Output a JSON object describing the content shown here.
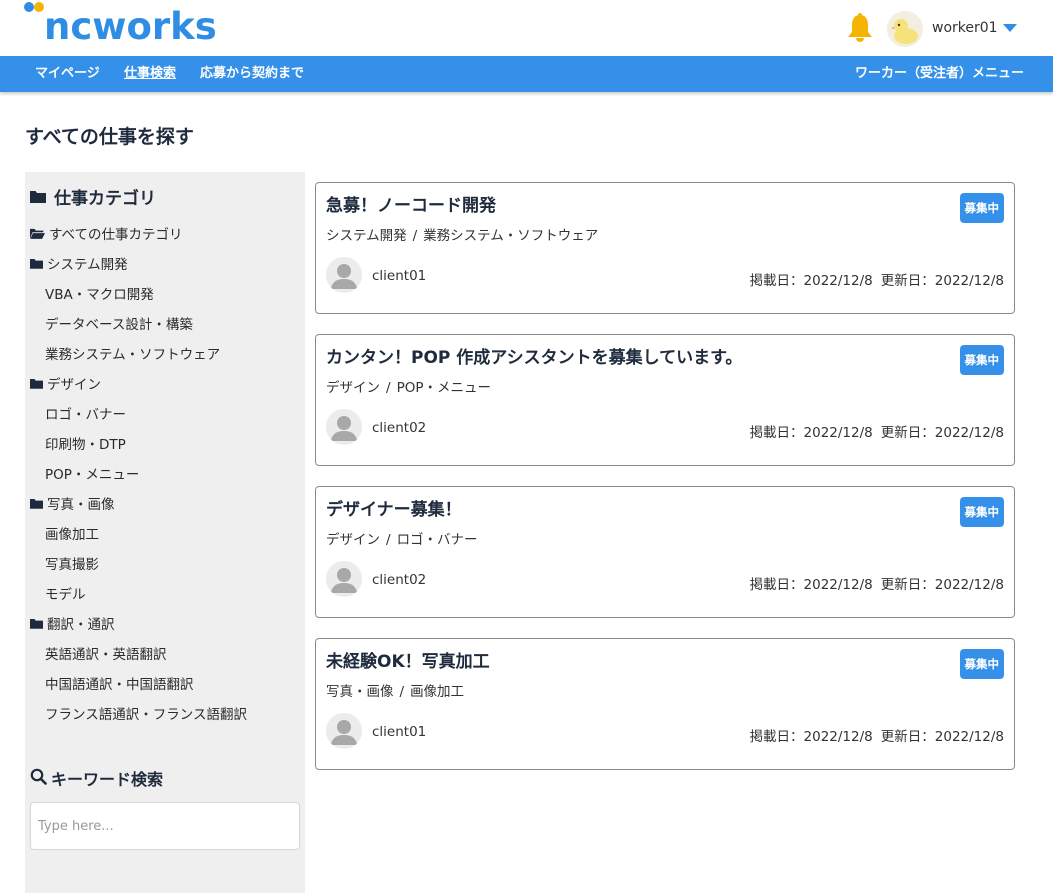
{
  "header": {
    "logo_text": "ncworks",
    "username": "worker01",
    "colors": {
      "brand": "#2f8de4",
      "logo_dot_yellow": "#f5b400",
      "bell": "#f5b400"
    },
    "icons": [
      "bell-icon",
      "user-avatar-chick",
      "caret-down-icon"
    ]
  },
  "nav": {
    "items": [
      {
        "label": "マイページ",
        "active": false
      },
      {
        "label": "仕事検索",
        "active": true
      },
      {
        "label": "応募から契約まで",
        "active": false
      }
    ],
    "right_label": "ワーカー（受注者）メニュー",
    "color": "#3490e8"
  },
  "page_title": "すべての仕事を探す",
  "sidebar": {
    "category_heading": "仕事カテゴリ",
    "categories": [
      {
        "label": "すべての仕事カテゴリ",
        "level": "top",
        "icon": "folder-open-icon"
      },
      {
        "label": "システム開発",
        "level": "top",
        "icon": "folder-icon"
      },
      {
        "label": "VBA・マクロ開発",
        "level": "sub"
      },
      {
        "label": "データベース設計・構築",
        "level": "sub"
      },
      {
        "label": "業務システム・ソフトウェア",
        "level": "sub"
      },
      {
        "label": "デザイン",
        "level": "top",
        "icon": "folder-icon"
      },
      {
        "label": "ロゴ・バナー",
        "level": "sub"
      },
      {
        "label": "印刷物・DTP",
        "level": "sub"
      },
      {
        "label": "POP・メニュー",
        "level": "sub"
      },
      {
        "label": "写真・画像",
        "level": "top",
        "icon": "folder-icon"
      },
      {
        "label": "画像加工",
        "level": "sub"
      },
      {
        "label": "写真撮影",
        "level": "sub"
      },
      {
        "label": "モデル",
        "level": "sub"
      },
      {
        "label": "翻訳・通訳",
        "level": "top",
        "icon": "folder-icon"
      },
      {
        "label": "英語通訳・英語翻訳",
        "level": "sub"
      },
      {
        "label": "中国語通訳・中国語翻訳",
        "level": "sub"
      },
      {
        "label": "フランス語通訳・フランス語翻訳",
        "level": "sub"
      }
    ],
    "keyword_heading": "キーワード検索",
    "keyword_placeholder": "Type here...",
    "keyword_value": ""
  },
  "jobs": [
    {
      "title": "急募！ノーコード開発",
      "category": "システム開発",
      "subcategory": "業務システム・ソフトウェア",
      "client": "client01",
      "posted": "掲載日：2022/12/8",
      "updated": "更新日：2022/12/8",
      "status": "募集中"
    },
    {
      "title": "カンタン！POP 作成アシスタントを募集しています。",
      "category": "デザイン",
      "subcategory": "POP・メニュー",
      "client": "client02",
      "posted": "掲載日：2022/12/8",
      "updated": "更新日：2022/12/8",
      "status": "募集中"
    },
    {
      "title": "デザイナー募集！",
      "category": "デザイン",
      "subcategory": "ロゴ・バナー",
      "client": "client02",
      "posted": "掲載日：2022/12/8",
      "updated": "更新日：2022/12/8",
      "status": "募集中"
    },
    {
      "title": "未経験OK！写真加工",
      "category": "写真・画像",
      "subcategory": "画像加工",
      "client": "client01",
      "posted": "掲載日：2022/12/8",
      "updated": "更新日：2022/12/8",
      "status": "募集中"
    }
  ]
}
